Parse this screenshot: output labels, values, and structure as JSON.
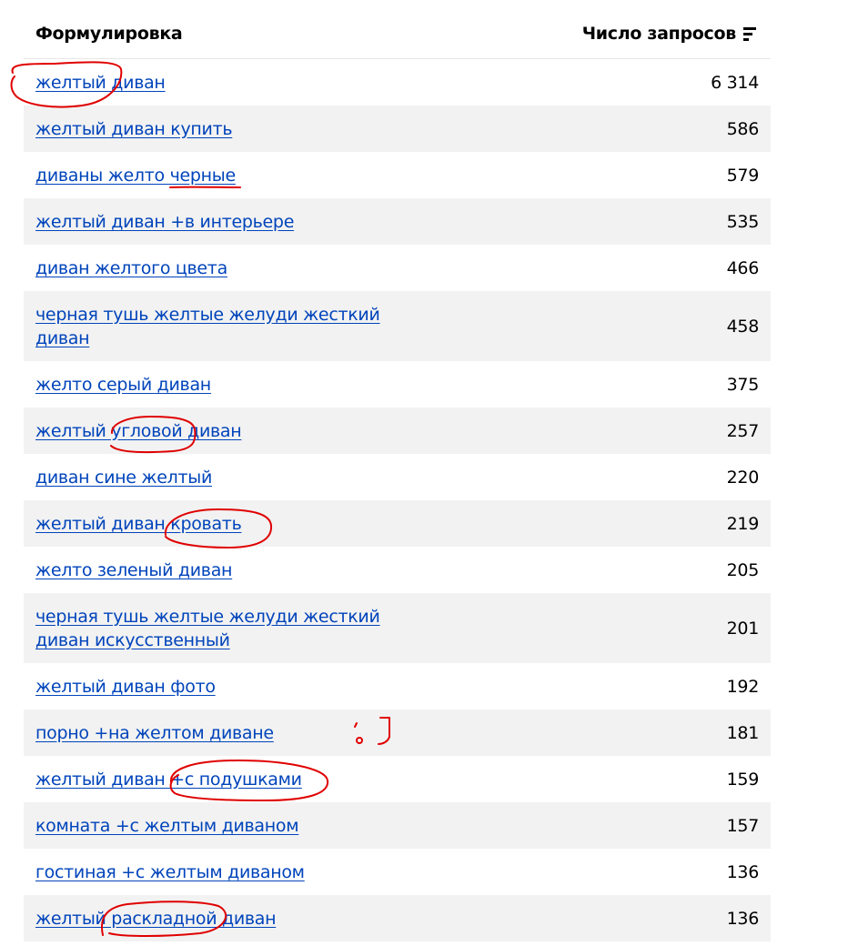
{
  "header": {
    "phrase_label": "Формулировка",
    "count_label": "Число запросов",
    "sort_icon": "sort-descending-icon"
  },
  "colors": {
    "link": "#0044bb",
    "stripe": "#f2f2f2",
    "annotation": "#e00000"
  },
  "rows": [
    {
      "phrase": "желтый диван",
      "count": "6 314"
    },
    {
      "phrase": "желтый диван купить",
      "count": "586"
    },
    {
      "phrase": "диваны желто черные",
      "count": "579"
    },
    {
      "phrase": "желтый диван +в интерьере",
      "count": "535"
    },
    {
      "phrase": "диван желтого цвета",
      "count": "466"
    },
    {
      "phrase": "черная тушь желтые желуди жесткий диван",
      "count": "458"
    },
    {
      "phrase": "желто серый диван",
      "count": "375"
    },
    {
      "phrase": "желтый угловой диван",
      "count": "257"
    },
    {
      "phrase": "диван сине желтый",
      "count": "220"
    },
    {
      "phrase": "желтый диван кровать",
      "count": "219"
    },
    {
      "phrase": "желто зеленый диван",
      "count": "205"
    },
    {
      "phrase": "черная тушь желтые желуди жесткий диван искусственный",
      "count": "201"
    },
    {
      "phrase": "желтый диван фото",
      "count": "192"
    },
    {
      "phrase": "порно +на желтом диване",
      "count": "181"
    },
    {
      "phrase": "желтый диван +с подушками",
      "count": "159"
    },
    {
      "phrase": "комната +с желтым диваном",
      "count": "157"
    },
    {
      "phrase": "гостиная +с желтым диваном",
      "count": "136"
    },
    {
      "phrase": "желтый раскладной диван",
      "count": "136"
    }
  ]
}
